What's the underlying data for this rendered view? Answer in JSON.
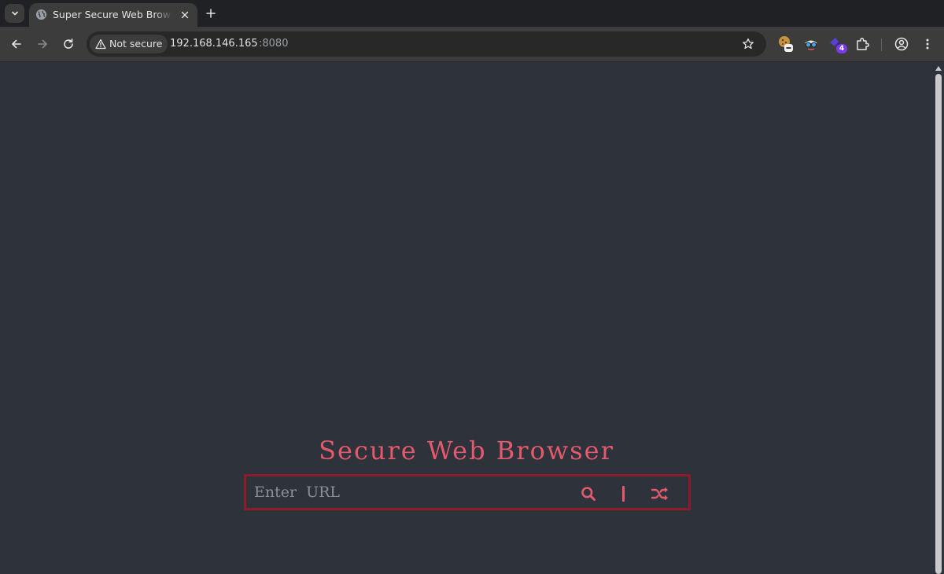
{
  "browser": {
    "tabs": [
      {
        "title": "Super Secure Web Browser",
        "active": true
      }
    ],
    "toolbar": {
      "security_label": "Not secure",
      "url_host": "192.168.146.165",
      "url_port": ":8080",
      "extensions": [
        {
          "icon": "cookie-extension-icon"
        },
        {
          "icon": "spy-extension-icon"
        },
        {
          "icon": "shield-extension-icon",
          "badge": "4"
        },
        {
          "icon": "puzzle-extensions-icon"
        }
      ]
    },
    "colors": {
      "tabstrip": "#202124",
      "toolbar": "#3c3c3c",
      "page_bg": "#2e323b"
    }
  },
  "page": {
    "title": "Secure Web Browser",
    "search": {
      "placeholder": "Enter URL",
      "value": ""
    },
    "accent_color": "#e35a6c",
    "border_color": "#8f1b2a"
  }
}
